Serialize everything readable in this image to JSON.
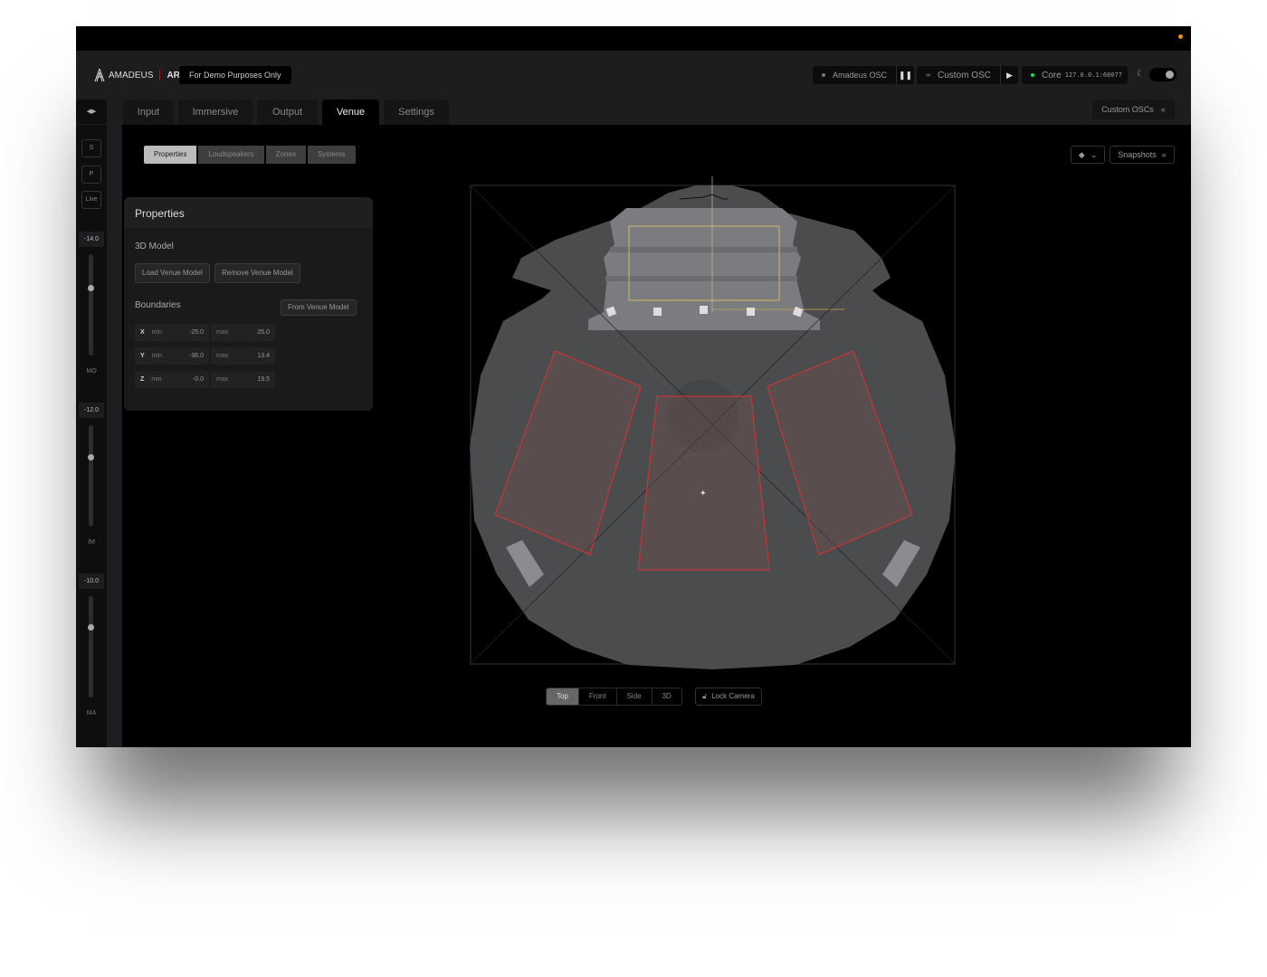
{
  "header": {
    "brand": "AMADEUS",
    "product": "ART",
    "demo_badge": "For Demo Purposes Only",
    "amadeus_osc": "Amadeus OSC",
    "custom_osc": "Custom OSC",
    "core_label": "Core",
    "core_address": "127.0.0.1:60077",
    "core_status_color": "#22dd55",
    "theme_toggle": "dark"
  },
  "tabs": [
    {
      "label": "Input"
    },
    {
      "label": "Immersive"
    },
    {
      "label": "Output"
    },
    {
      "label": "Venue",
      "active": true
    },
    {
      "label": "Settings"
    }
  ],
  "custom_oscs_label": "Custom OSCs",
  "left_strip": {
    "buttons": [
      "S",
      "P",
      "Live"
    ],
    "faders": [
      {
        "value": "-14.0",
        "label": "MO",
        "level": 0.67
      },
      {
        "value": "-12.0",
        "label": "IM",
        "level": 0.69
      },
      {
        "value": "-10.0",
        "label": "MA",
        "level": 0.7
      }
    ]
  },
  "subtabs": [
    {
      "label": "Properties",
      "active": true
    },
    {
      "label": "Loudspeakers"
    },
    {
      "label": "Zones"
    },
    {
      "label": "Systems"
    }
  ],
  "panel": {
    "title": "Properties",
    "model_heading": "3D Model",
    "load_button": "Load Venue Model",
    "remove_button": "Remove Venue Model",
    "boundaries_heading": "Boundaries",
    "from_model_button": "From Venue Model",
    "bounds": [
      {
        "axis": "X",
        "min_label": "min",
        "min": "-25.0",
        "max_label": "max",
        "max": "25.0"
      },
      {
        "axis": "Y",
        "min_label": "min",
        "min": "-36.0",
        "max_label": "max",
        "max": "13.4"
      },
      {
        "axis": "Z",
        "min_label": "min",
        "min": "-0.0",
        "max_label": "max",
        "max": "19.5"
      }
    ]
  },
  "snapshots_label": "Snapshots",
  "view_buttons": [
    {
      "label": "Top",
      "active": true
    },
    {
      "label": "Front"
    },
    {
      "label": "Side"
    },
    {
      "label": "3D"
    }
  ],
  "lock_camera": "Lock Camera",
  "colors": {
    "zone_outline": "#e03030",
    "stage_outline": "#d4b860",
    "orange_dot": "#f0901a"
  }
}
